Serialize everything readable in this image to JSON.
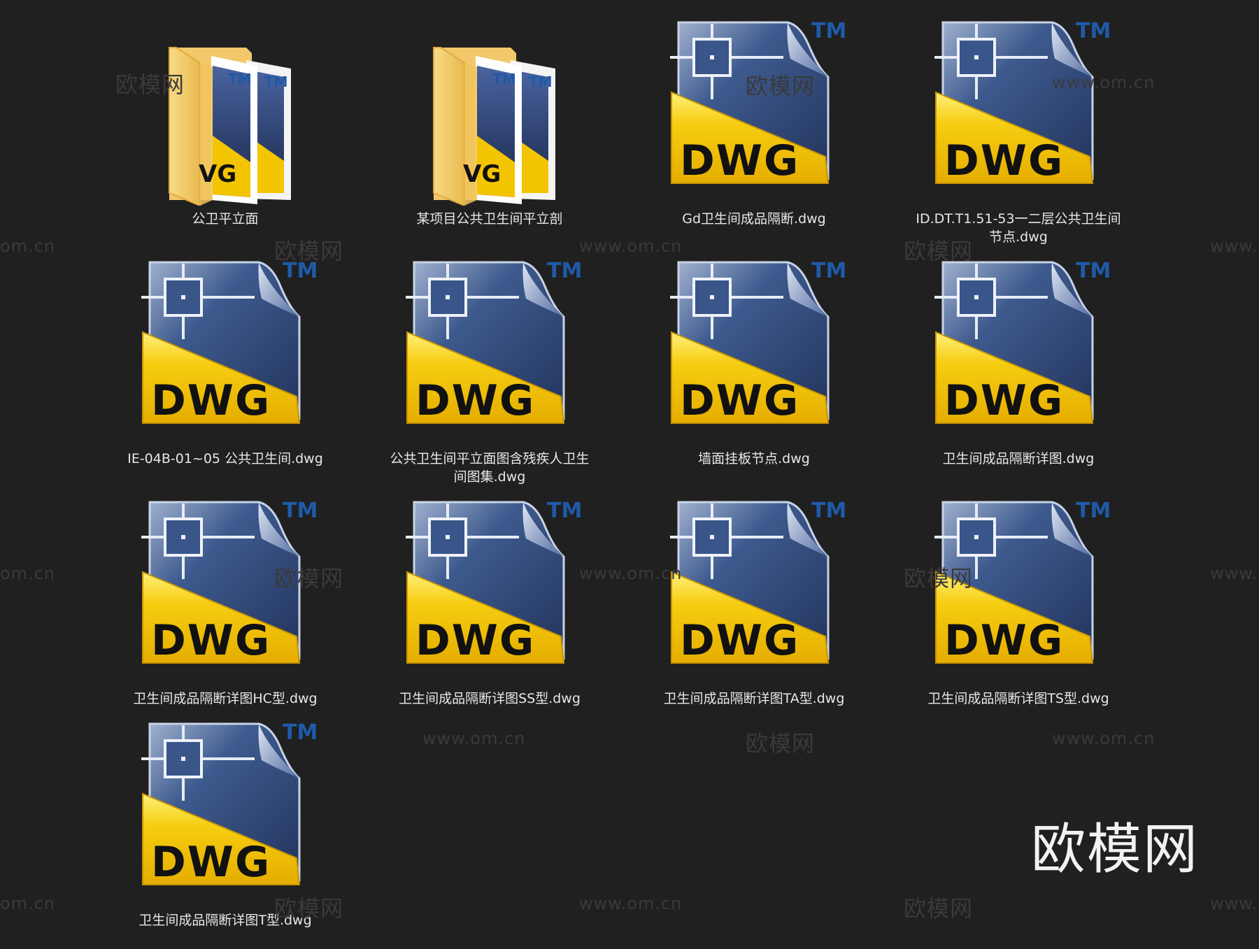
{
  "watermark": {
    "brand_cn": "欧模网",
    "site": "www.om.cn",
    "partial_left": "om.cn",
    "partial_right": "www."
  },
  "corner_brand": "欧模网",
  "icon_text": {
    "dwg": "DWG",
    "dwg_partial": "VG",
    "tm": "TM"
  },
  "colors": {
    "background": "#202020",
    "folder": "#f3cf6b",
    "dwg_yellow": "#f3c400",
    "dwg_blue": "#2f4a7e",
    "tm_blue": "#1f5aa8"
  },
  "files": [
    {
      "name": "公卫平立面",
      "type": "folder",
      "icon": "folder-dwg-icon"
    },
    {
      "name": "某项目公共卫生间平立剖",
      "type": "folder",
      "icon": "folder-dwg-icon"
    },
    {
      "name": "Gd卫生间成品隔断.dwg",
      "type": "dwg",
      "icon": "dwg-file-icon"
    },
    {
      "name": "ID.DT.T1.51-53一二层公共卫生间节点.dwg",
      "type": "dwg",
      "icon": "dwg-file-icon"
    },
    {
      "name": "IE-04B-01~05 公共卫生间.dwg",
      "type": "dwg",
      "icon": "dwg-file-icon"
    },
    {
      "name": "公共卫生间平立面图含残疾人卫生间图集.dwg",
      "type": "dwg",
      "icon": "dwg-file-icon"
    },
    {
      "name": "墙面挂板节点.dwg",
      "type": "dwg",
      "icon": "dwg-file-icon"
    },
    {
      "name": "卫生间成品隔断详图.dwg",
      "type": "dwg",
      "icon": "dwg-file-icon"
    },
    {
      "name": "卫生间成品隔断详图HC型.dwg",
      "type": "dwg",
      "icon": "dwg-file-icon"
    },
    {
      "name": "卫生间成品隔断详图SS型.dwg",
      "type": "dwg",
      "icon": "dwg-file-icon"
    },
    {
      "name": "卫生间成品隔断详图TA型.dwg",
      "type": "dwg",
      "icon": "dwg-file-icon"
    },
    {
      "name": "卫生间成品隔断详图TS型.dwg",
      "type": "dwg",
      "icon": "dwg-file-icon"
    },
    {
      "name": "卫生间成品隔断详图T型.dwg",
      "type": "dwg",
      "icon": "dwg-file-icon"
    }
  ]
}
